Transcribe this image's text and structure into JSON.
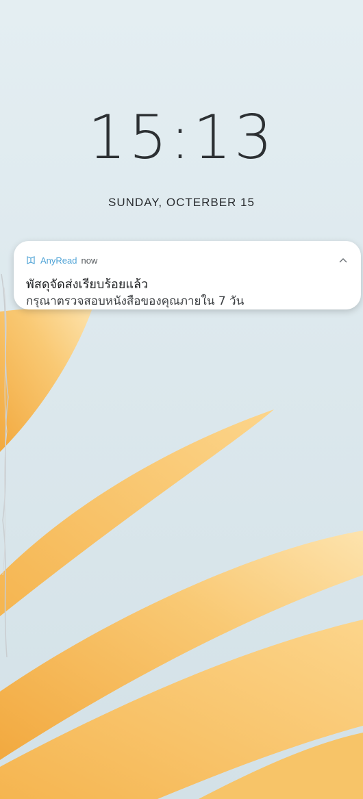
{
  "lockscreen": {
    "time": "15:13",
    "date": "SUNDAY, OCTERBER 15"
  },
  "notification": {
    "app_icon": "book-icon",
    "app_name": "AnyRead",
    "time": "now",
    "title": "พัสดุจัดส่งเรียบร้อยแล้ว",
    "body": "กรุณาตรวจสอบหนังสือของคุณภายใน 7 วัน",
    "expand_icon": "chevron-up-icon"
  },
  "colors": {
    "background": "#dce7ec",
    "petal": "#f6bb5c",
    "petal_light": "#fbd88f",
    "accent": "#4fa3d6"
  }
}
